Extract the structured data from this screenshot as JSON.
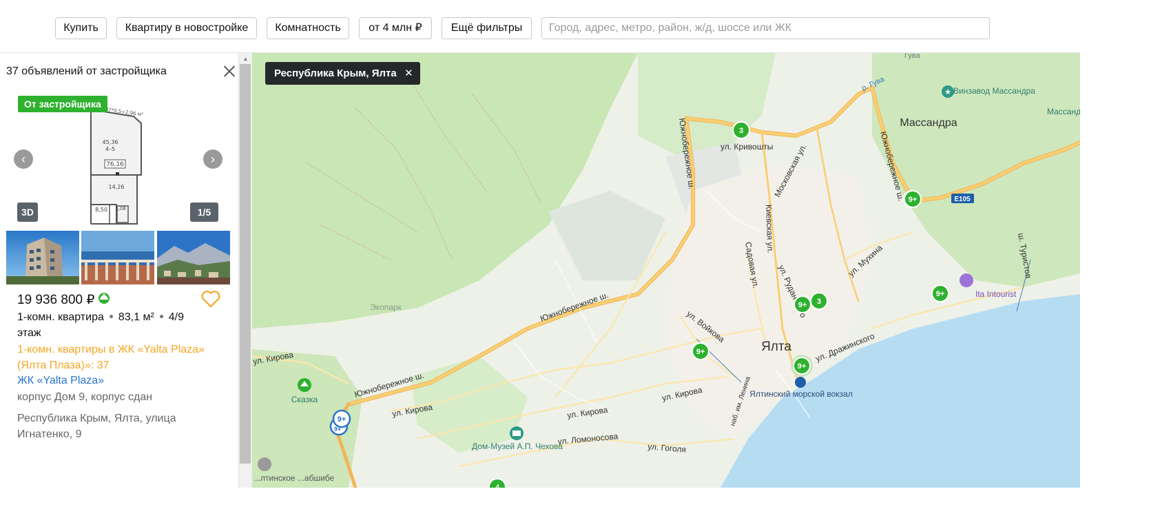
{
  "filters": {
    "buy": "Купить",
    "type": "Квартиру в новостройке",
    "rooms": "Комнатность",
    "price": "от 4 млн ₽",
    "more": "Ещё фильтры",
    "search_placeholder": "Город, адрес, метро, район, ж/д, шоссе или ЖК"
  },
  "panel": {
    "count": "37 объявлений от застройщика",
    "badge_developer": "От застройщика",
    "badge_3d": "3D",
    "photo_counter": "1/5",
    "plan_labels": {
      "area_total": "76,16",
      "room": "45,36",
      "rooms_range": "4–5",
      "kitchen": "14,26",
      "bath1": "8,50",
      "bath2": "5,08"
    },
    "listing": {
      "price": "19 936 800 ₽",
      "rooms": "1-комн. квартира",
      "area": "83,1 м²",
      "floor_label": "4/9",
      "floor_word": "этаж",
      "complex_link": "1-комн. квартиры в ЖК «Yalta Plaza» (Ялта Плаза)»: 37",
      "complex_name": "ЖК «Yalta Plaza»",
      "building": "корпус Дом 9, корпус сдан",
      "address": "Республика Крым, Ялта, улица Игнатенко, 9"
    }
  },
  "map": {
    "region_chip": "Республика Крым, Ялта",
    "labels": {
      "yalta": "Ялта",
      "massandra": "Массандра",
      "massandra_winery": "Винзавод Массандра",
      "massandra_park": "Массанд... парк",
      "ekopark": "Экопарк",
      "skazka": "Сказка",
      "chekhov_museum": "Дом-Музей А.П. Чехова",
      "sea_station": "Ялтинский морской вокзал",
      "intourist": "Ita Intourist",
      "guva": "Гува",
      "river_guva": "р. Гува",
      "e105": "E105",
      "yalt_embankment": "...лтинское ...абшибе"
    },
    "streets": {
      "yuzhnob1": "Южнобережное ш.",
      "yuzhnob2": "Южнобережное ш.",
      "yuzhnob3": "Южнобережное ш.",
      "yuzhnob4": "Южнобережное ш.",
      "krivoshty": "ул. Кривошты",
      "moskovskaya": "Московская ул.",
      "kievskaya": "Киевская ул.",
      "sadovaya": "Садовая ул.",
      "rudanskogo": "ул. Руданского",
      "mukhina": "ул. Мухина",
      "voykova": "ул. Войкова",
      "kirova1": "ул. Кирова",
      "kirova2": "ул. Кирова",
      "kirova3": "ул. Кирова",
      "kirova4": "ул. Кирова",
      "lomonosova": "ул. Ломоносова",
      "gogolya": "ул. Гоголя",
      "dra": "ул. Дражинского",
      "lenina": "наб. им. Ленина",
      "turistov": "ш. Туристов"
    },
    "markers": {
      "m1": "3",
      "m2": "9+",
      "m3": "9+",
      "m4": "3",
      "m5": "9+",
      "m6": "9+",
      "m7": "9+",
      "m8": "9+",
      "m9": "9+",
      "m10": "4"
    },
    "colors": {
      "marker_green": "#2fb130",
      "marker_blue": "#2a73cc",
      "sea": "#b6dcf2",
      "forest": "#c8e6b6",
      "road": "#f8cf72"
    }
  }
}
